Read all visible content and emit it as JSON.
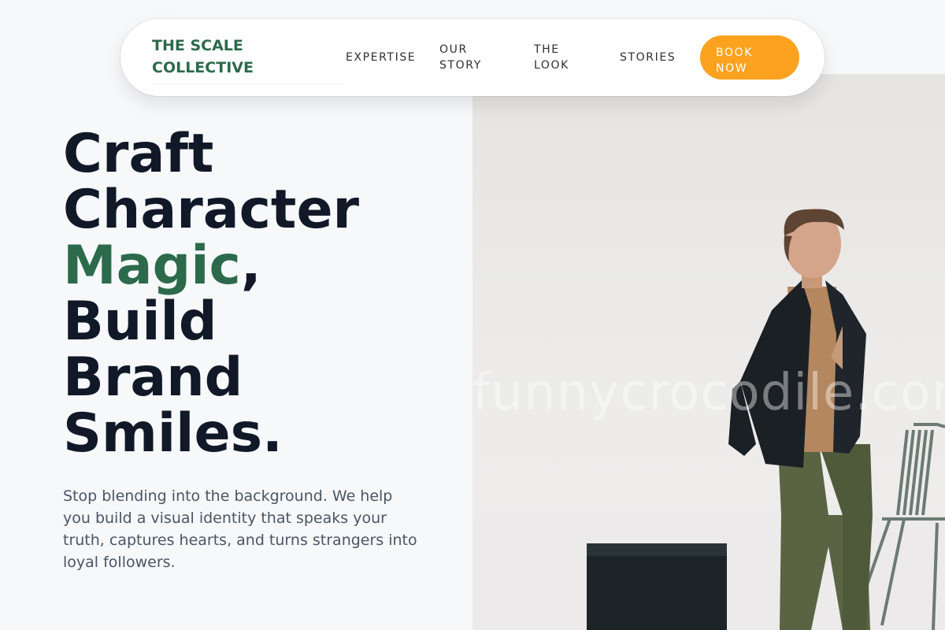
{
  "nav": {
    "brand_line1": "THE SCALE",
    "brand_line2": "COLLECTIVE",
    "links": [
      {
        "label": "EXPERTISE"
      },
      {
        "label_line1": "OUR",
        "label_line2": "STORY"
      },
      {
        "label_line1": "THE",
        "label_line2": "LOOK"
      },
      {
        "label": "STORIES"
      }
    ],
    "cta_line1": "BOOK",
    "cta_line2": "NOW"
  },
  "hero": {
    "headline": {
      "line1": "Craft",
      "line2": "Character",
      "accent_word": "Magic",
      "accent_suffix": ",",
      "line4": "Build",
      "line5": "Brand",
      "line6": "Smiles."
    },
    "description": "Stop blending into the background. We help you build a visual identity that speaks your truth, captures hearts, and turns strangers into loyal followers.",
    "image_watermark": "funnycrocodile.com"
  },
  "colors": {
    "brand_green": "#2c6a4b",
    "cta_orange": "#fca21f",
    "headline_dark": "#111827",
    "page_background": "#f6f8fa"
  }
}
